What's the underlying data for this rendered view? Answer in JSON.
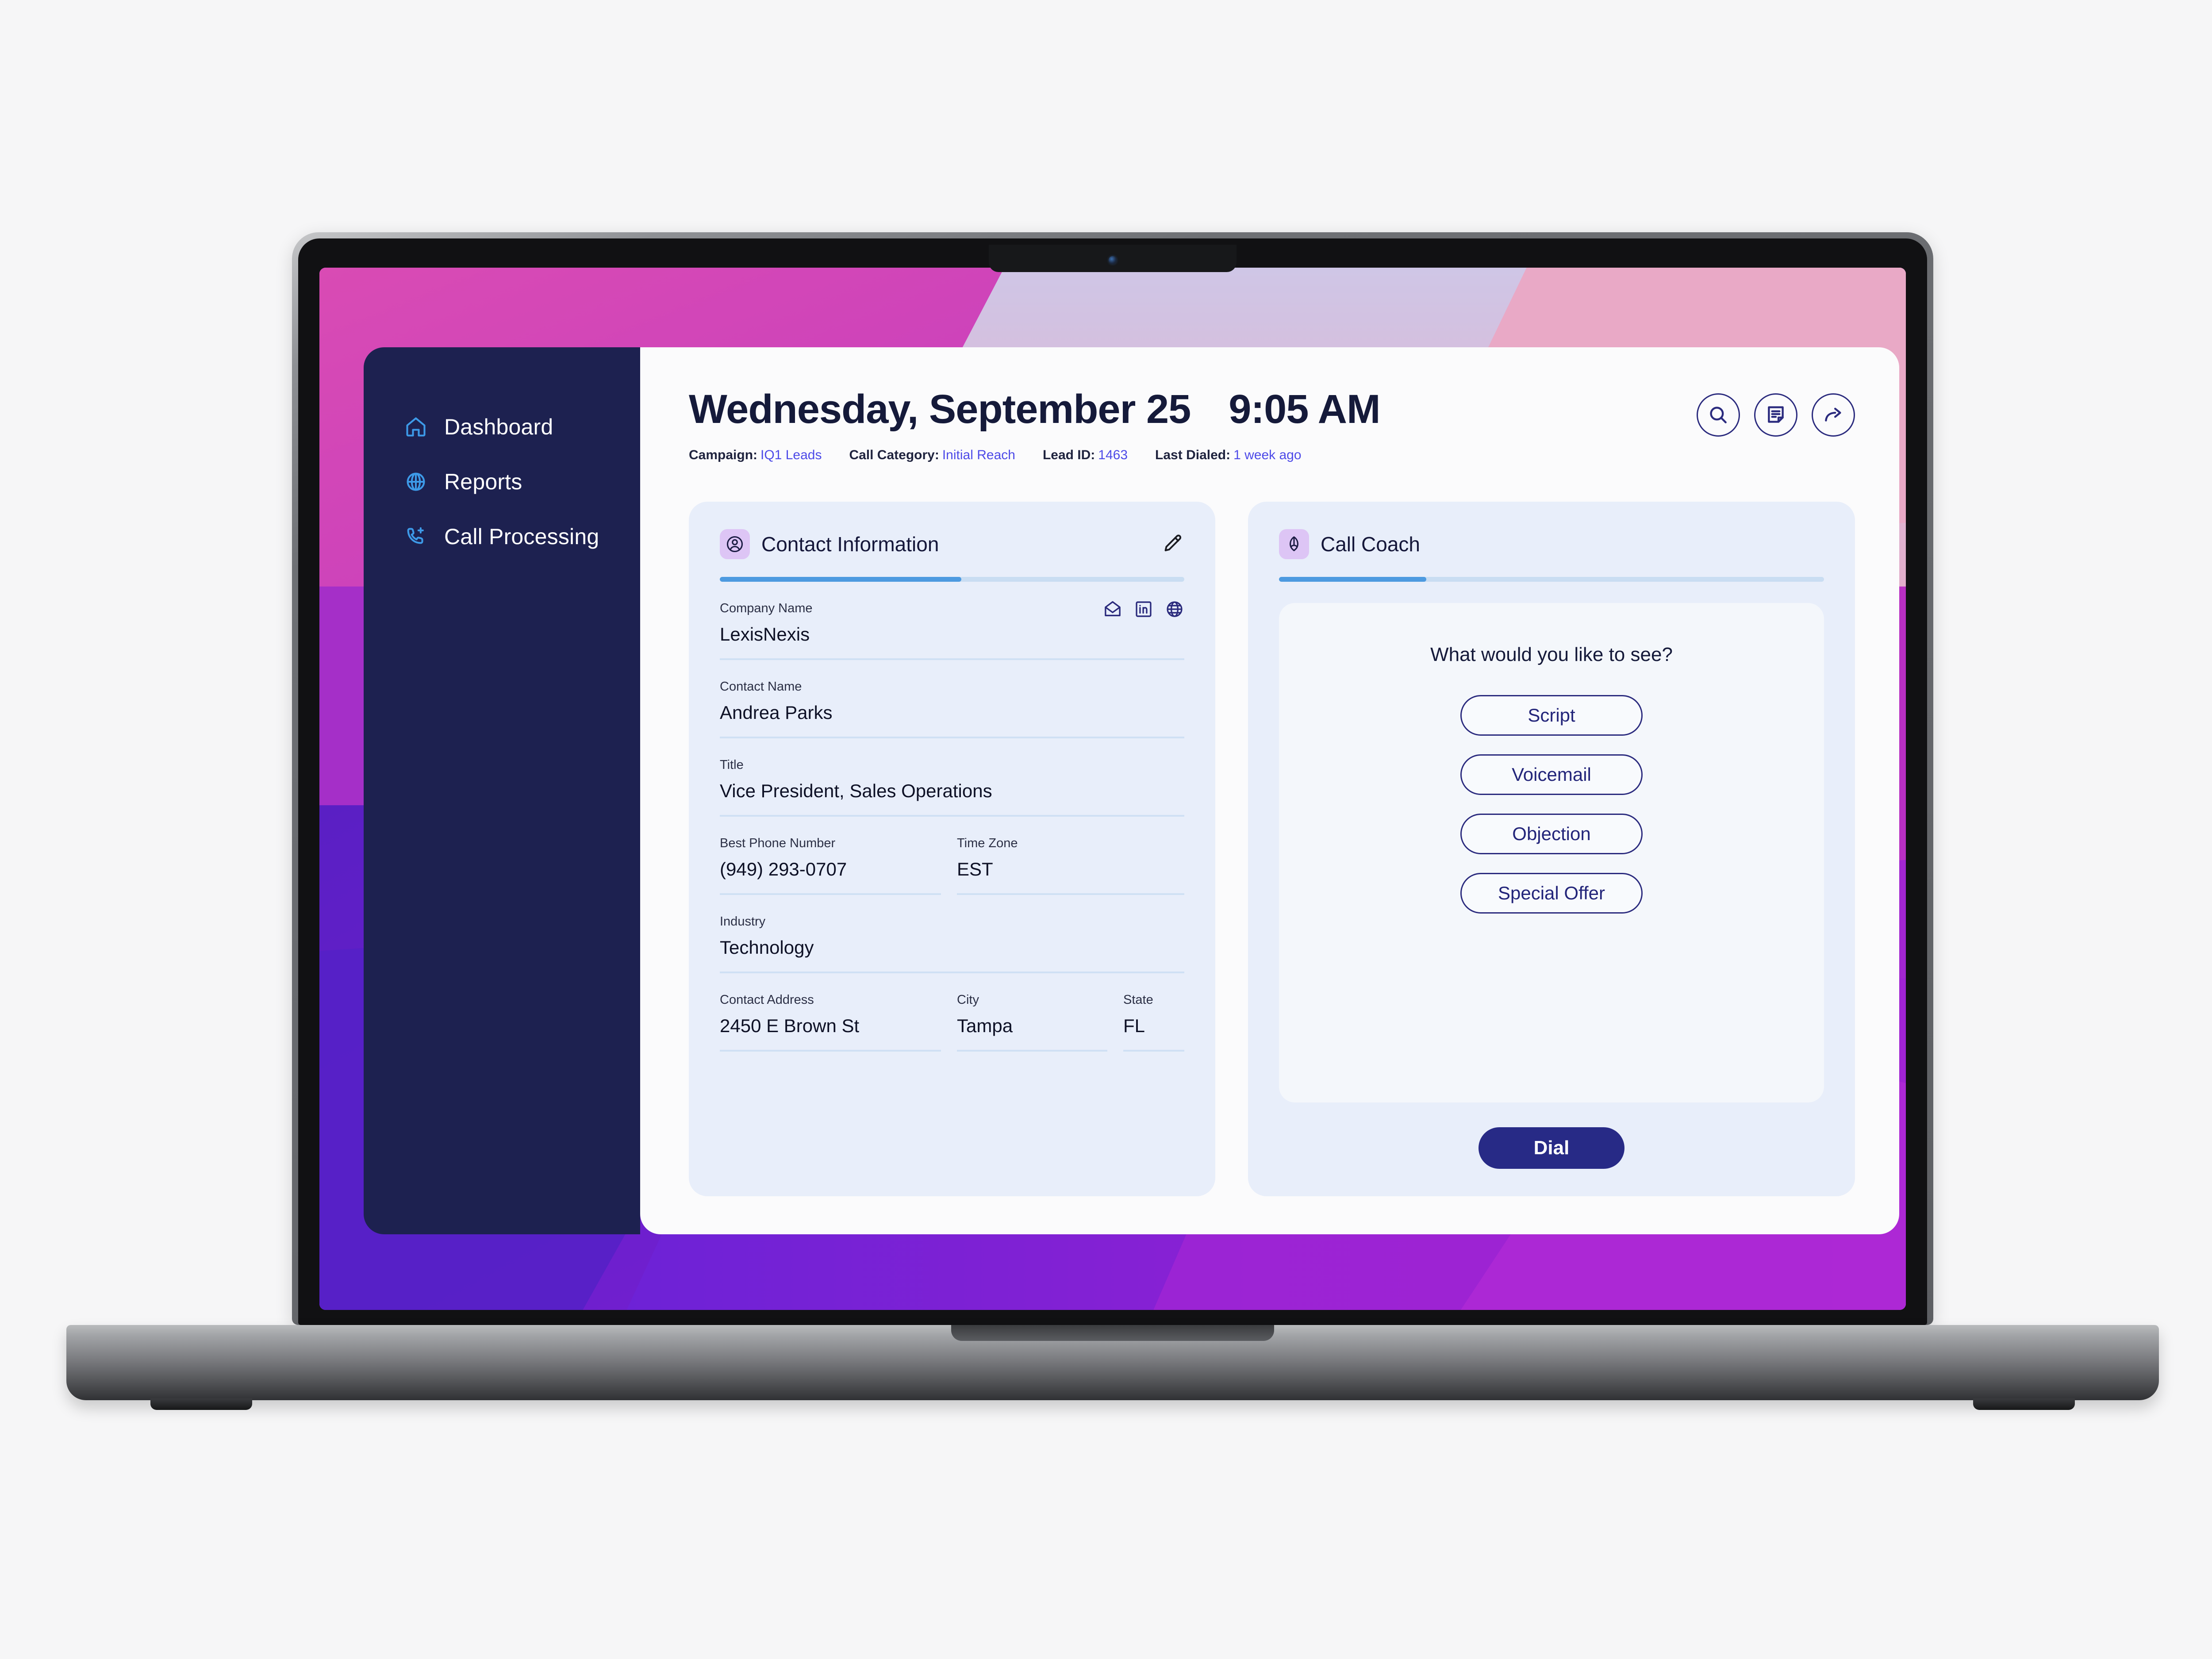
{
  "sidebar": {
    "items": [
      {
        "label": "Dashboard",
        "icon": "home-icon"
      },
      {
        "label": "Reports",
        "icon": "globe-target-icon"
      },
      {
        "label": "Call Processing",
        "icon": "phone-plus-icon"
      }
    ]
  },
  "header": {
    "date": "Wednesday, September 25",
    "time": "9:05 AM",
    "meta": [
      {
        "label": "Campaign:",
        "value": "IQ1 Leads"
      },
      {
        "label": "Call Category:",
        "value": "Initial Reach"
      },
      {
        "label": "Lead ID:",
        "value": "1463"
      },
      {
        "label": "Last Dialed:",
        "value": "1 week ago"
      }
    ],
    "actions": [
      {
        "name": "search-button",
        "icon": "search-icon"
      },
      {
        "name": "notes-button",
        "icon": "notes-icon"
      },
      {
        "name": "forward-button",
        "icon": "forward-arrow-icon"
      }
    ]
  },
  "contact_card": {
    "title": "Contact Information",
    "badge_icon": "user-circle-icon",
    "edit_icon": "pencil-icon",
    "progress_percent": 52,
    "social_icons": [
      "email-icon",
      "linkedin-icon",
      "website-globe-icon"
    ],
    "fields": {
      "company_label": "Company Name",
      "company_value": "LexisNexis",
      "contact_name_label": "Contact Name",
      "contact_name_value": "Andrea Parks",
      "title_label": "Title",
      "title_value": "Vice President, Sales Operations",
      "phone_label": "Best Phone Number",
      "phone_value": "(949) 293-0707",
      "timezone_label": "Time Zone",
      "timezone_value": "EST",
      "industry_label": "Industry",
      "industry_value": "Technology",
      "address_label": "Contact Address",
      "address_value": "2450 E Brown St",
      "city_label": "City",
      "city_value": "Tampa",
      "state_label": "State",
      "state_value": "FL"
    }
  },
  "call_coach": {
    "title": "Call Coach",
    "badge_icon": "coach-icon",
    "progress_percent": 27,
    "prompt": "What would you like to see?",
    "options": [
      {
        "label": "Script"
      },
      {
        "label": "Voicemail"
      },
      {
        "label": "Objection"
      },
      {
        "label": "Special Offer"
      }
    ],
    "dial_label": "Dial"
  },
  "colors": {
    "sidebar_bg": "#1d2150",
    "card_bg": "#e8eefa",
    "accent_navy": "#272a86",
    "link_blue": "#4d4ae8",
    "progress_fill": "#4d9ae0",
    "badge_purple": "#ddc5f5",
    "nav_icon_blue": "#3d9ae8"
  }
}
